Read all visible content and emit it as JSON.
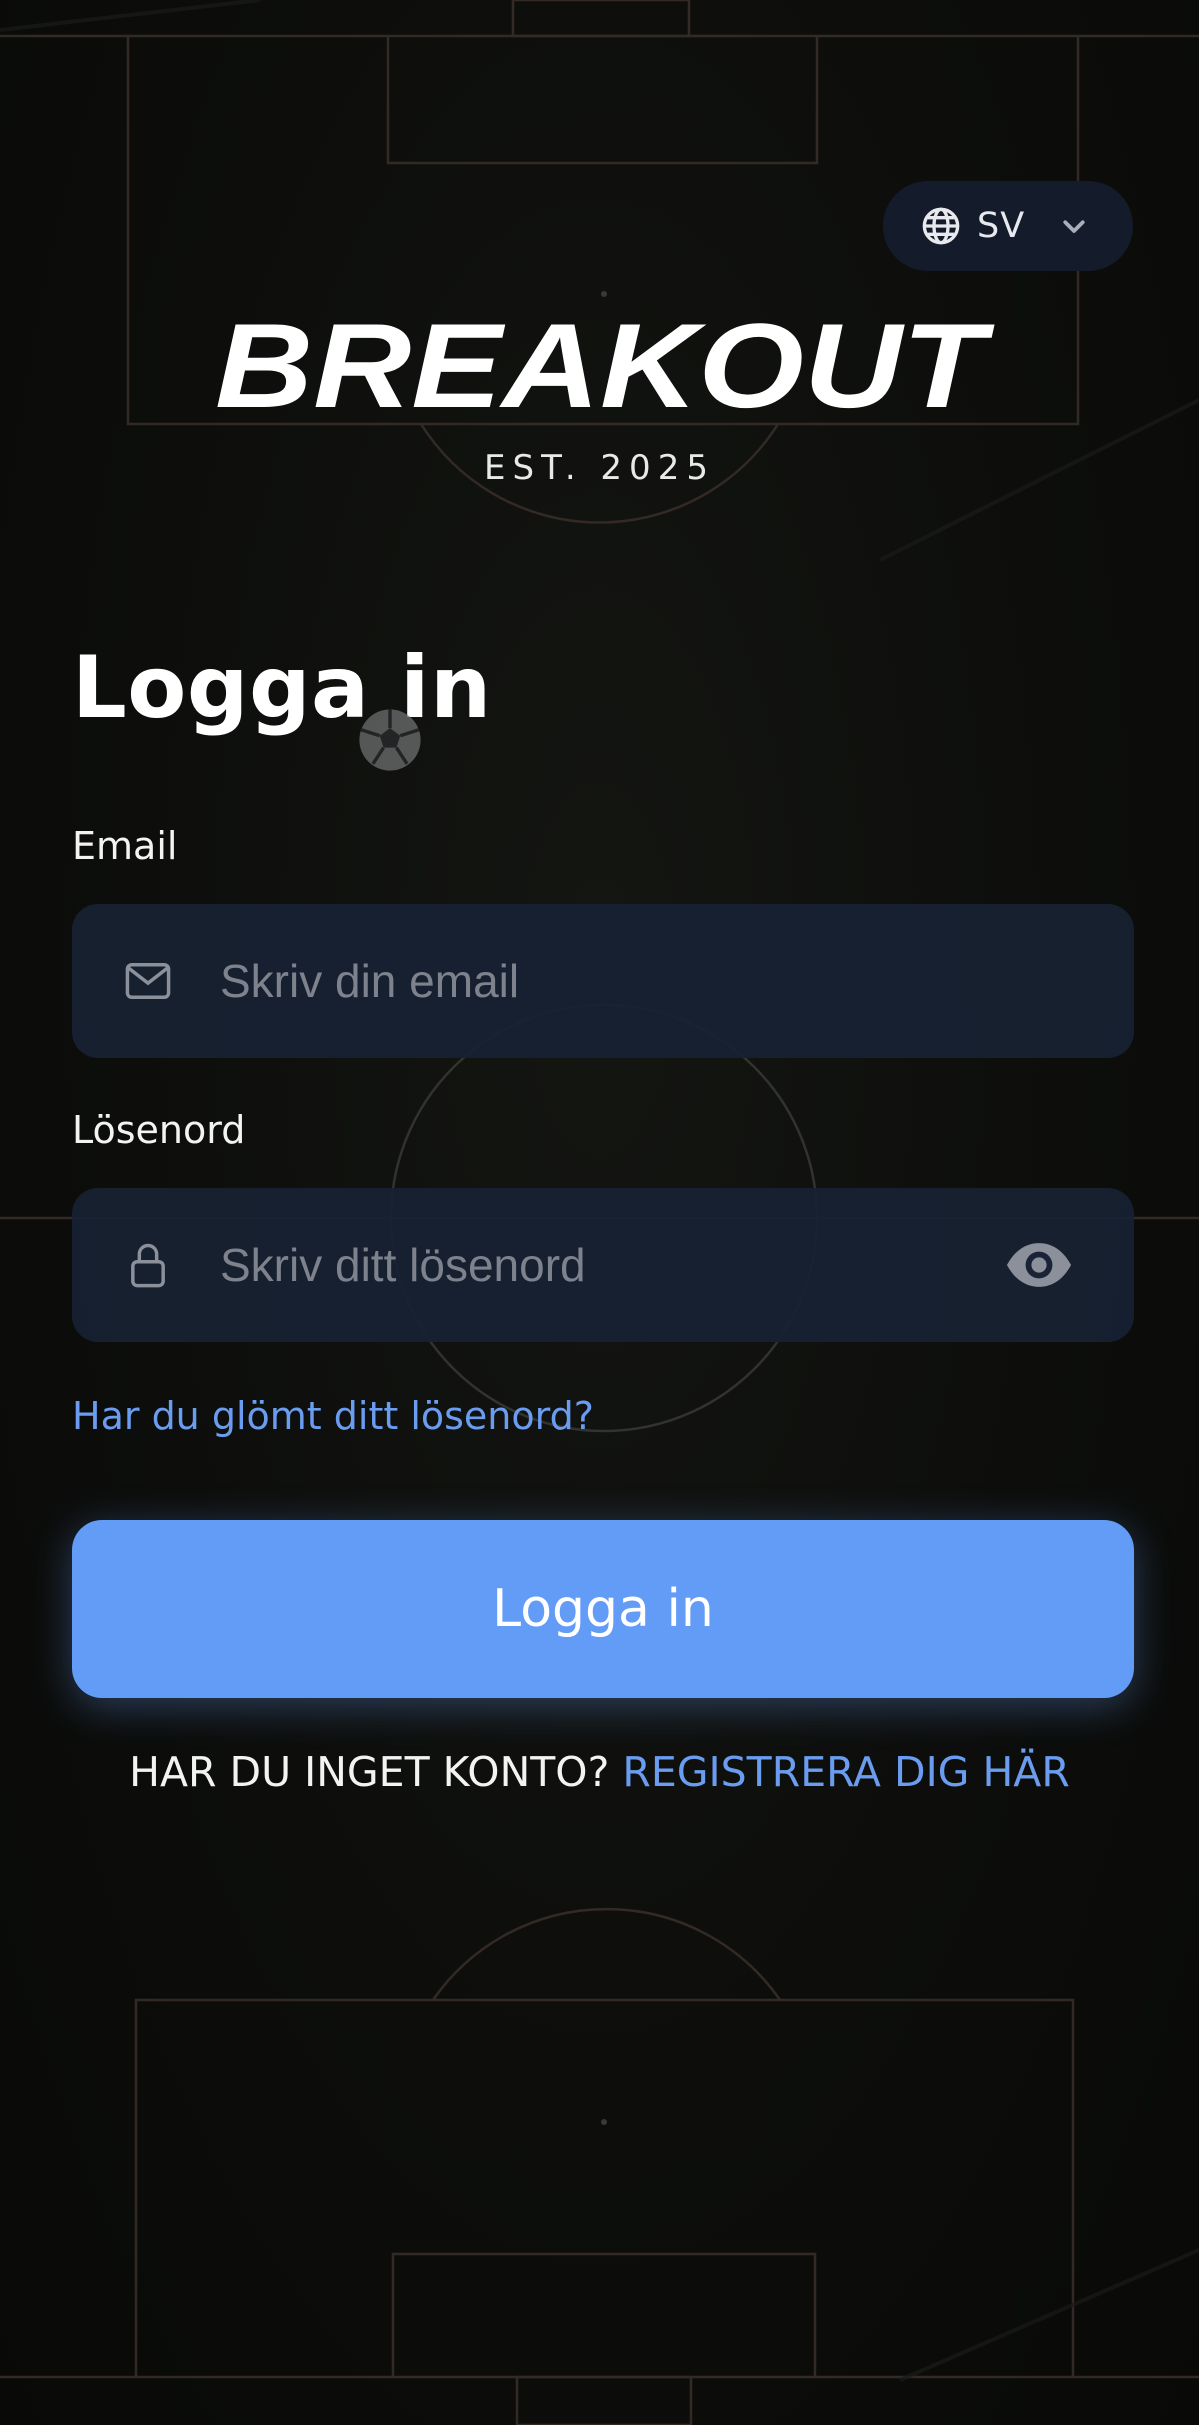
{
  "language": {
    "code": "SV"
  },
  "brand": {
    "name": "BREAKOUT",
    "tagline": "EST. 2025"
  },
  "login": {
    "title": "Logga in",
    "email_label": "Email",
    "email_placeholder": "Skriv din email",
    "password_label": "Lösenord",
    "password_placeholder": "Skriv ditt lösenord",
    "forgot_link": "Har du glömt ditt lösenord?",
    "submit_label": "Logga in",
    "no_account_text": "HAR DU INGET KONTO?",
    "register_link": "REGISTRERA DIG HÄR"
  },
  "icons": {
    "language": "globe-icon",
    "dropdown": "chevron-down-icon",
    "email": "envelope-icon",
    "password": "lock-icon",
    "show_password": "eye-icon",
    "decoration": "soccer-ball-icon"
  },
  "colors": {
    "background": "#0b0c0a",
    "field": "#182133",
    "accent": "#639cf6",
    "link": "#6a9cf0",
    "text": "#ffffff"
  }
}
